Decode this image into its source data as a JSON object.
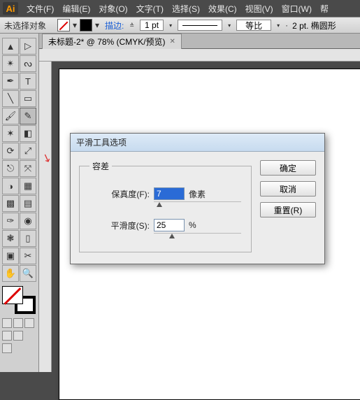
{
  "app": {
    "logo": "Ai"
  },
  "menu": [
    "文件(F)",
    "编辑(E)",
    "对象(O)",
    "文字(T)",
    "选择(S)",
    "效果(C)",
    "视图(V)",
    "窗口(W)",
    "帮"
  ],
  "options": {
    "no_selection": "未选择对象",
    "stroke_label": "描边:",
    "stroke_pt": "1 pt",
    "ratio_label": "等比",
    "ellipse_label": "2 pt. 椭圆形"
  },
  "document": {
    "tab_title": "未标题-2* @ 78% (CMYK/预览)"
  },
  "dialog": {
    "title": "平滑工具选项",
    "group_label": "容差",
    "fidelity_label": "保真度(F):",
    "fidelity_value": "7",
    "fidelity_unit": "像素",
    "smoothness_label": "平滑度(S):",
    "smoothness_value": "25",
    "smoothness_unit": "%",
    "ok": "确定",
    "cancel": "取消",
    "reset": "重置(R)"
  }
}
